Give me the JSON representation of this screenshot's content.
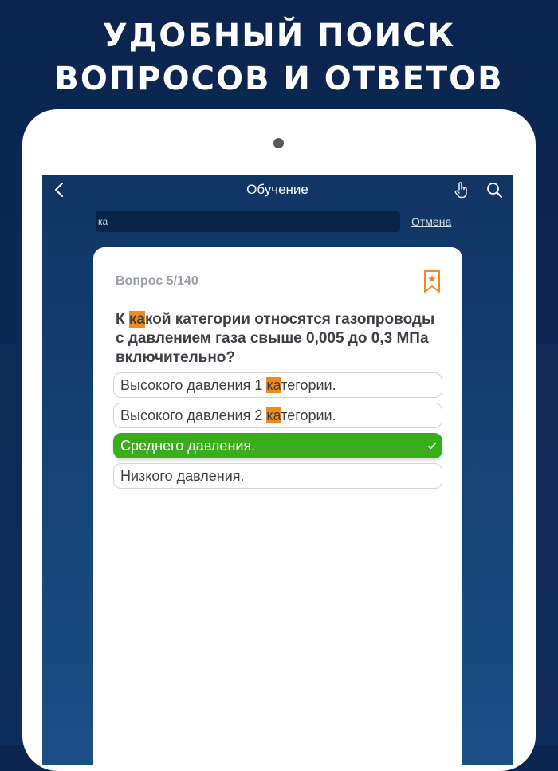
{
  "promo": {
    "line1": "УДОБНЫЙ ПОИСК",
    "line2": "ВОПРОСОВ И ОТВЕТОВ"
  },
  "nav": {
    "title": "Обучение",
    "back_icon": "chevron-left-icon",
    "hand_icon": "hand-pointer-icon",
    "search_icon": "search-icon"
  },
  "search": {
    "value": "ка",
    "cancel_label": "Отмена"
  },
  "question": {
    "counter": "Вопрос 5/140",
    "text_before": "К ",
    "text_highlight": "ка",
    "text_after": "кой категории относятся газопроводы с давлением газа свыше 0,005 до 0,3 МПа включительно?",
    "bookmark_icon": "bookmark-star-icon"
  },
  "answers": [
    {
      "before": "Высокого давления 1 ",
      "highlight": "ка",
      "after": "тегории.",
      "correct": false
    },
    {
      "before": "Высокого давления 2 ",
      "highlight": "ка",
      "after": "тегории.",
      "correct": false
    },
    {
      "before": "Среднего давления.",
      "highlight": "",
      "after": "",
      "correct": true
    },
    {
      "before": "Низкого давления.",
      "highlight": "",
      "after": "",
      "correct": false
    }
  ],
  "colors": {
    "background": "#0d2a55",
    "highlight": "#f28a1a",
    "correct": "#3aae1a",
    "bookmark": "#f28a1a"
  }
}
